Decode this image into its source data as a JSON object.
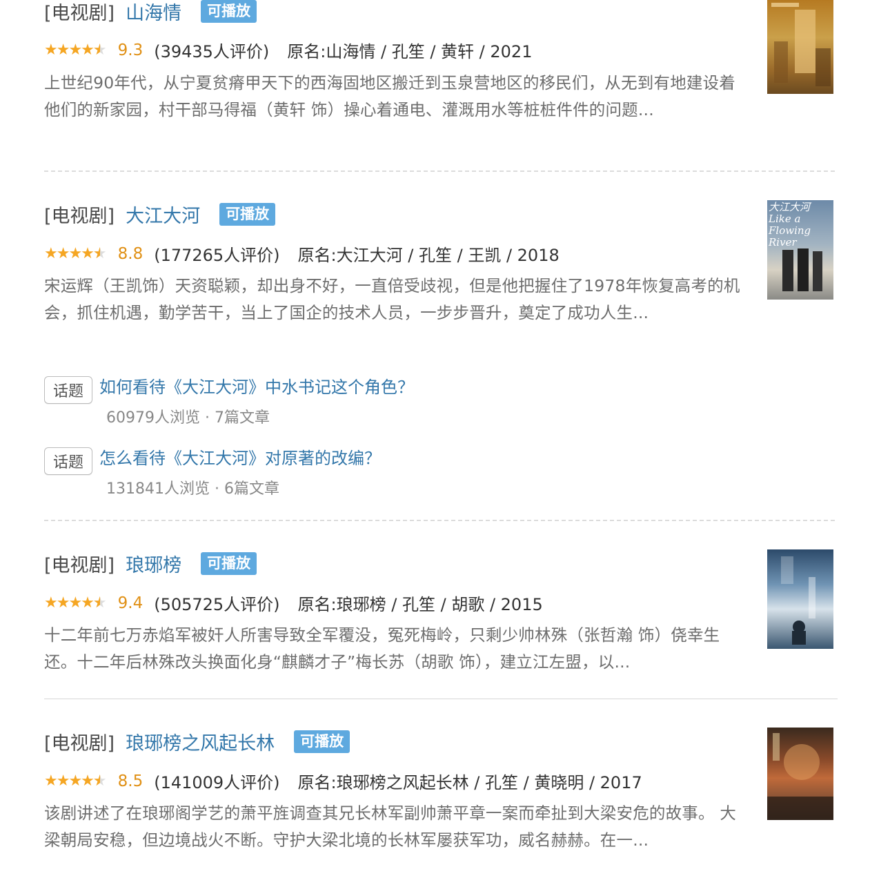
{
  "results": [
    {
      "category": "[电视剧]",
      "title": "山海情",
      "playable": "可播放",
      "stars": "★★★★",
      "score": "9.3",
      "count": "(39435人评价)",
      "original": "原名:山海情 / 孔笙 / 黄轩 / 2021",
      "description": "上世纪90年代，从宁夏贫瘠甲天下的西海固地区搬迁到玉泉营地区的移民们，从无到有地建设着他们的新家园，村干部马得福（黄轩 饰）操心着通电、灌溉用水等桩桩件件的问题..."
    },
    {
      "category": "[电视剧]",
      "title": "大江大河",
      "playable": "可播放",
      "stars": "★★★★",
      "score": "8.8",
      "count": "(177265人评价)",
      "original": "原名:大江大河 / 孔笙 / 王凯 / 2018",
      "description": "宋运辉（王凯饰）天资聪颖，却出身不好，一直倍受歧视，但是他把握住了1978年恢复高考的机会，抓住机遇，勤学苦干，当上了国企的技术人员，一步步晋升，奠定了成功人生...",
      "poster_text": "大江大河 Like a Flowing River"
    },
    {
      "category": "[电视剧]",
      "title": "琅琊榜",
      "playable": "可播放",
      "stars": "★★★★",
      "score": "9.4",
      "count": "(505725人评价)",
      "original": "原名:琅琊榜 / 孔笙 / 胡歌 / 2015",
      "description": "十二年前七万赤焰军被奸人所害导致全军覆没，冤死梅岭，只剩少帅林殊（张哲瀚 饰）侥幸生还。十二年后林殊改头换面化身“麒麟才子”梅长苏（胡歌 饰），建立江左盟，以..."
    },
    {
      "category": "[电视剧]",
      "title": "琅琊榜之风起长林",
      "playable": "可播放",
      "stars": "★★★★",
      "score": "8.5",
      "count": "(141009人评价)",
      "original": "原名:琅琊榜之风起长林 / 孔笙 / 黄晓明 / 2017",
      "description": "该剧讲述了在琅琊阁学艺的萧平旌调查其兄长林军副帅萧平章一案而牵扯到大梁安危的故事。 大梁朝局安稳，但边境战火不断。守护大梁北境的长林军屡获军功，威名赫赫。在一..."
    }
  ],
  "topics": [
    {
      "tag": "话题",
      "title": "如何看待《大江大河》中水书记这个角色？",
      "stats": "60979人浏览 · 7篇文章"
    },
    {
      "tag": "话题",
      "title": "怎么看待《大江大河》对原著的改编？",
      "stats": "131841人浏览 · 6篇文章"
    }
  ],
  "rating_stars": {
    "full": 4,
    "half": 1
  },
  "colors": {
    "link": "#3377aa",
    "badge": "#5ea9df",
    "star": "#f5a623",
    "score": "#e09015"
  }
}
